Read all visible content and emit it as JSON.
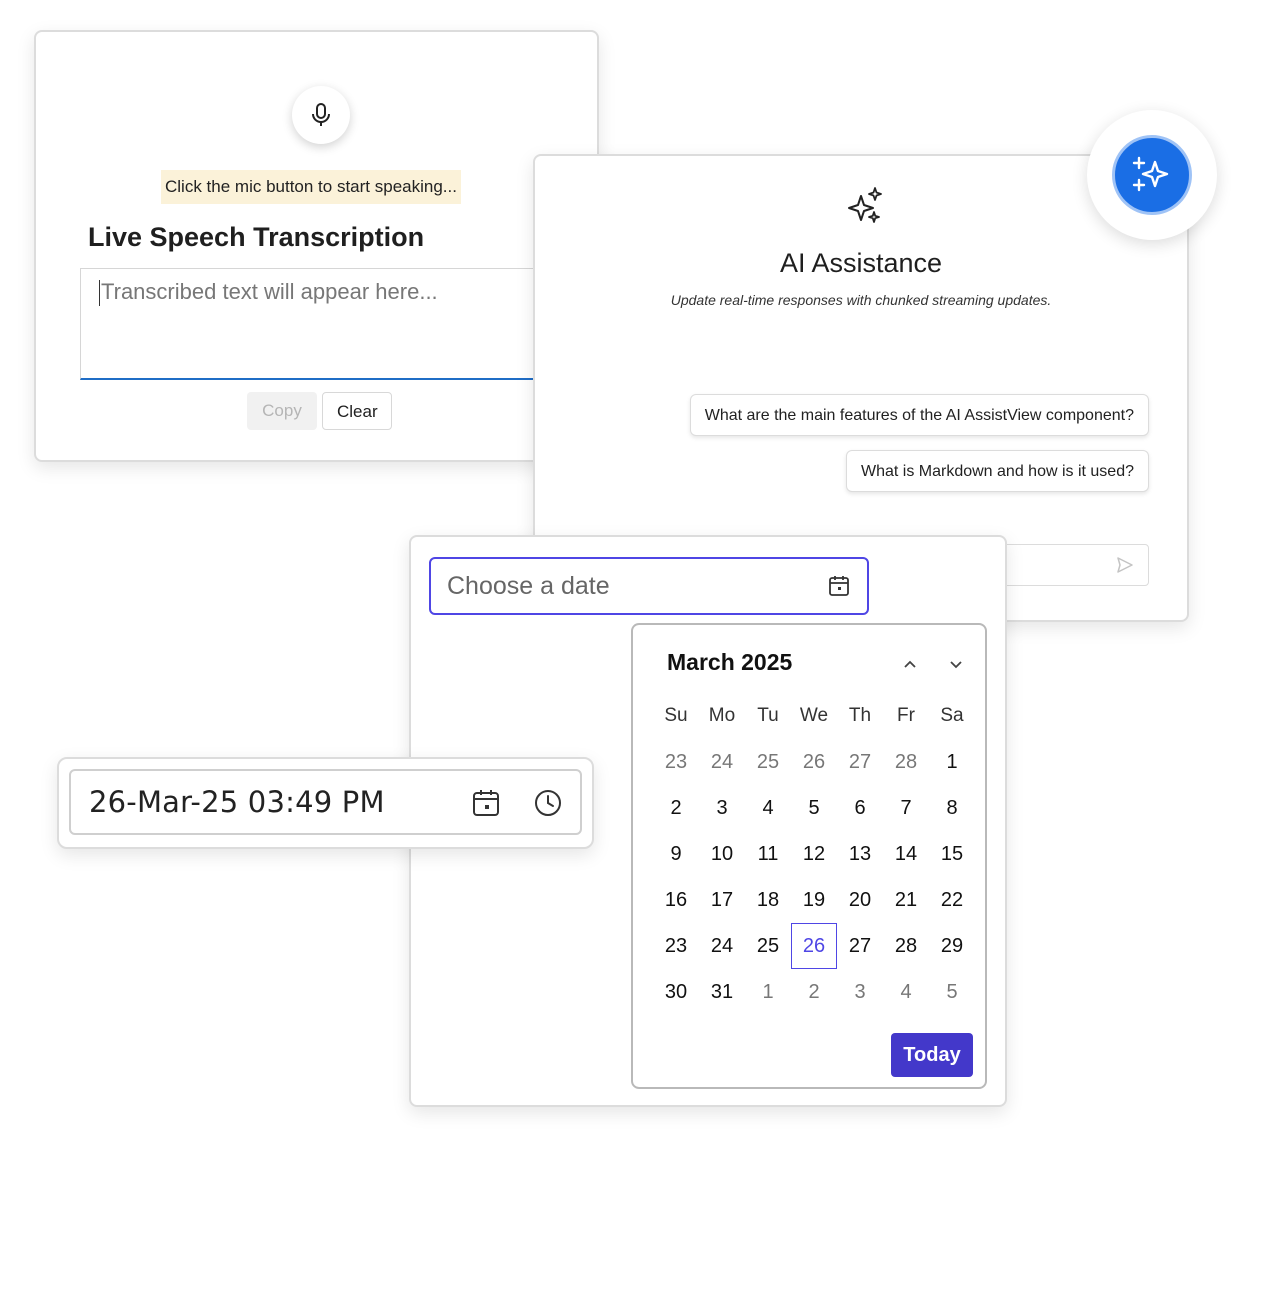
{
  "speech": {
    "hint": "Click the mic button to start speaking...",
    "title": "Live Speech Transcription",
    "placeholder": "Transcribed text will appear here...",
    "copy_label": "Copy",
    "clear_label": "Clear"
  },
  "ai": {
    "title": "AI Assistance",
    "subtitle": "Update real-time responses with chunked streaming updates.",
    "suggestions": [
      "What are the main features of the AI AssistView component?",
      "What is Markdown and how is it used?"
    ],
    "accent": "#1a6ee5"
  },
  "datepicker": {
    "placeholder": "Choose a date",
    "month_title": "March 2025",
    "weekdays": [
      "Su",
      "Mo",
      "Tu",
      "We",
      "Th",
      "Fr",
      "Sa"
    ],
    "weeks": [
      [
        {
          "d": "23",
          "o": true
        },
        {
          "d": "24",
          "o": true
        },
        {
          "d": "25",
          "o": true
        },
        {
          "d": "26",
          "o": true
        },
        {
          "d": "27",
          "o": true
        },
        {
          "d": "28",
          "o": true
        },
        {
          "d": "1"
        }
      ],
      [
        {
          "d": "2"
        },
        {
          "d": "3"
        },
        {
          "d": "4"
        },
        {
          "d": "5"
        },
        {
          "d": "6"
        },
        {
          "d": "7"
        },
        {
          "d": "8"
        }
      ],
      [
        {
          "d": "9"
        },
        {
          "d": "10"
        },
        {
          "d": "11"
        },
        {
          "d": "12"
        },
        {
          "d": "13"
        },
        {
          "d": "14"
        },
        {
          "d": "15"
        }
      ],
      [
        {
          "d": "16"
        },
        {
          "d": "17"
        },
        {
          "d": "18"
        },
        {
          "d": "19"
        },
        {
          "d": "20"
        },
        {
          "d": "21"
        },
        {
          "d": "22"
        }
      ],
      [
        {
          "d": "23"
        },
        {
          "d": "24"
        },
        {
          "d": "25"
        },
        {
          "d": "26",
          "sel": true
        },
        {
          "d": "27"
        },
        {
          "d": "28"
        },
        {
          "d": "29"
        }
      ],
      [
        {
          "d": "30"
        },
        {
          "d": "31"
        },
        {
          "d": "1",
          "o": true
        },
        {
          "d": "2",
          "o": true
        },
        {
          "d": "3",
          "o": true
        },
        {
          "d": "4",
          "o": true
        },
        {
          "d": "5",
          "o": true
        }
      ]
    ],
    "today_label": "Today",
    "accent": "#4f46e5"
  },
  "datetime": {
    "value": "26-Mar-25 03:49 PM"
  }
}
